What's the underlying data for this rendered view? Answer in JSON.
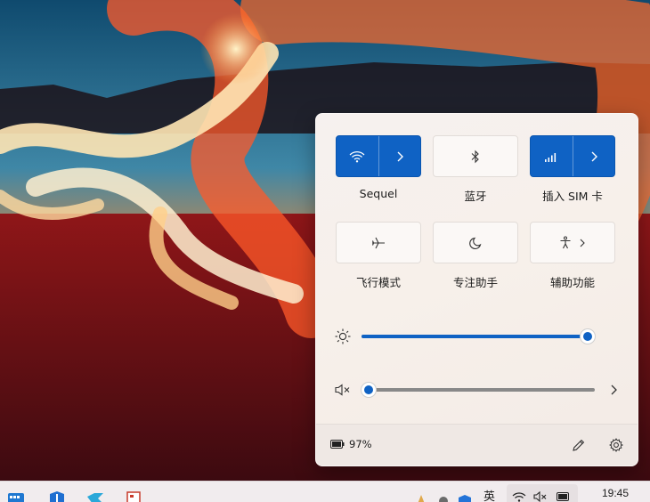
{
  "quick_settings": {
    "wifi": {
      "label": "Sequel",
      "icon": "wifi-icon",
      "state": "on"
    },
    "bluetooth": {
      "label": "蓝牙",
      "icon": "bluetooth-icon",
      "state": "off"
    },
    "cellular": {
      "label": "插入 SIM 卡",
      "icon": "cellular-signal-icon",
      "state": "on"
    },
    "airplane": {
      "label": "飞行模式",
      "icon": "airplane-icon",
      "state": "off"
    },
    "focus": {
      "label": "专注助手",
      "icon": "moon-icon",
      "state": "off"
    },
    "accessibility": {
      "label": "辅助功能",
      "icon": "accessibility-icon",
      "state": "off"
    },
    "brightness": {
      "icon": "sun-icon",
      "level": 1.0
    },
    "volume": {
      "icon": "speaker-muted-icon",
      "level": 0.0
    },
    "battery": {
      "icon": "battery-icon",
      "percent_text": "97%"
    },
    "footer": {
      "edit_icon": "pencil-icon",
      "settings_icon": "gear-icon"
    }
  },
  "taskbar": {
    "pinned_icons": [
      "start-icon",
      "security-icon",
      "app-icon",
      "document-icon"
    ],
    "tray_language": "英",
    "tray_icons": [
      "wifi-icon",
      "speaker-muted-icon",
      "battery-icon"
    ],
    "clock_time": "19:45"
  },
  "colors": {
    "accent": "#0f62c4",
    "panel_bg": "#f6f1ef",
    "tile_off": "#fbf8f6"
  }
}
